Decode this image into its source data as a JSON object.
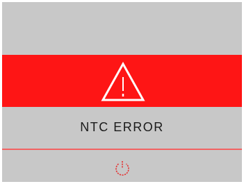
{
  "error": {
    "message": "NTC ERROR",
    "icon": "warning-icon"
  },
  "controls": {
    "power_icon": "power-icon"
  },
  "colors": {
    "background": "#c8c8c8",
    "alert_band": "#fe1515",
    "icon_stroke": "#ffffff",
    "divider": "#f26262",
    "power_icon": "#e53030",
    "text": "#1a1a1a"
  }
}
